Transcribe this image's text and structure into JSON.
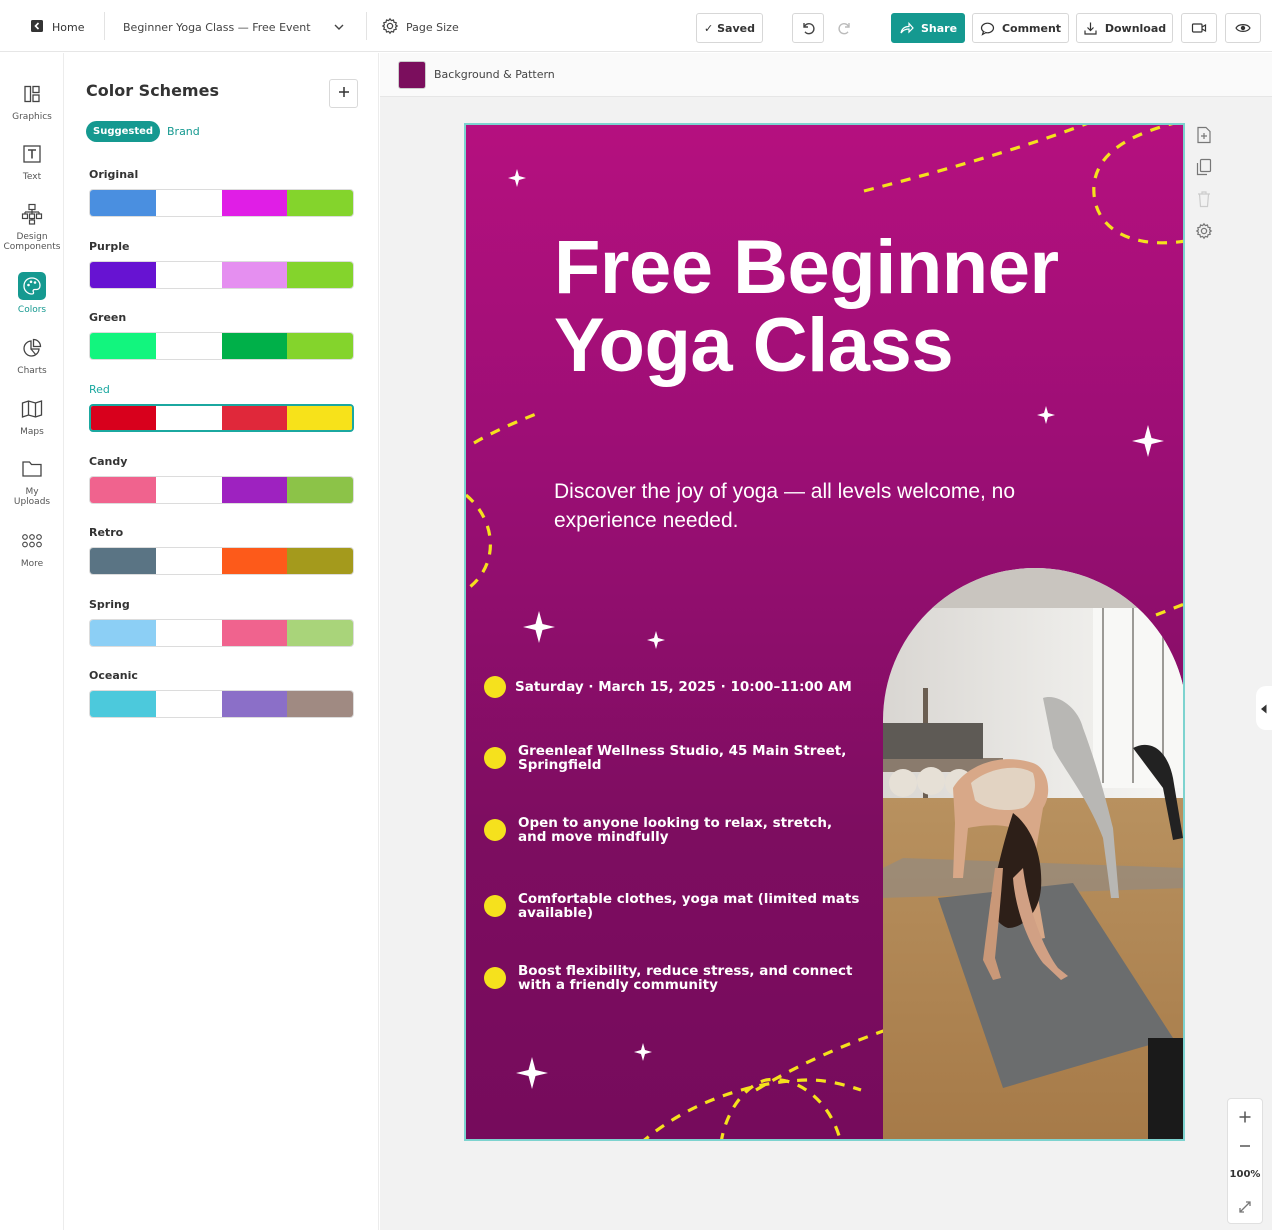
{
  "topbar": {
    "home_label": "Home",
    "doc_title": "Beginner Yoga Class — Free Event",
    "page_size_label": "Page Size",
    "saved_label": "✓ Saved",
    "share_label": "Share",
    "comment_label": "Comment",
    "download_label": "Download"
  },
  "rail": {
    "items": [
      {
        "label": "Graphics",
        "icon": "graphics-icon"
      },
      {
        "label": "Text",
        "icon": "text-icon"
      },
      {
        "label": "Design Components",
        "icon": "design-components-icon"
      },
      {
        "label": "Colors",
        "icon": "palette-icon"
      },
      {
        "label": "Charts",
        "icon": "pie-chart-icon"
      },
      {
        "label": "Maps",
        "icon": "map-icon"
      },
      {
        "label": "My Uploads",
        "icon": "folder-icon"
      },
      {
        "label": "More",
        "icon": "grid-dots-icon"
      }
    ],
    "active": "Colors"
  },
  "panel": {
    "title": "Color Schemes",
    "tabs": [
      "Suggested",
      "Brand"
    ],
    "active_tab": "Suggested",
    "schemes": [
      {
        "name": "Original",
        "colors": [
          "#4a8fe0",
          "#ffffff",
          "#e01ee6",
          "#84d42c"
        ]
      },
      {
        "name": "Purple",
        "colors": [
          "#6713d2",
          "#ffffff",
          "#e58ff0",
          "#84d42c"
        ]
      },
      {
        "name": "Green",
        "colors": [
          "#12f57e",
          "#ffffff",
          "#00b049",
          "#84d42c"
        ]
      },
      {
        "name": "Red",
        "colors": [
          "#d8001c",
          "#ffffff",
          "#e0283a",
          "#f7e21a"
        ],
        "selected": true
      },
      {
        "name": "Candy",
        "colors": [
          "#f0638e",
          "#ffffff",
          "#9e22c0",
          "#8cc348"
        ]
      },
      {
        "name": "Retro",
        "colors": [
          "#5a7484",
          "#ffffff",
          "#fd5a1a",
          "#a49a1c"
        ]
      },
      {
        "name": "Spring",
        "colors": [
          "#8ccff5",
          "#ffffff",
          "#f0638e",
          "#a9d47a"
        ]
      },
      {
        "name": "Oceanic",
        "colors": [
          "#4cc9dc",
          "#ffffff",
          "#8b6fc8",
          "#a08a82"
        ]
      }
    ]
  },
  "canvas": {
    "bg_bar_label": "Background & Pattern",
    "bg_color": "#7b0e5d",
    "zoom": "100%"
  },
  "flyer": {
    "title_line1": "Free Beginner",
    "title_line2": "Yoga Class",
    "subtitle": "Discover the joy of yoga — all levels welcome, no experience needed.",
    "details": [
      "Saturday · March 15, 2025 · 10:00–11:00 AM",
      "Greenleaf Wellness Studio, 45 Main Street, Springfield",
      "Open to anyone looking to relax, stretch, and move mindfully",
      "Comfortable clothes, yoga mat (limited mats available)",
      "Boost flexibility, reduce stress, and connect with a friendly community"
    ],
    "accent_color": "#f5e11d"
  }
}
